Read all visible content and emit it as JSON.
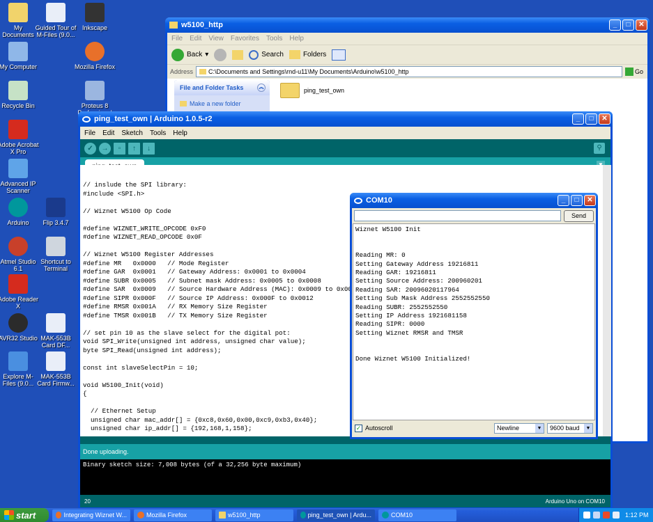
{
  "desktop": {
    "icons": [
      {
        "label": "My Documents",
        "color": "#f1d36b"
      },
      {
        "label": "Guided Tour of M-Files (9.0...",
        "color": "#e9eef8"
      },
      {
        "label": "Inkscape",
        "color": "#333333"
      },
      {
        "label": "My Computer",
        "color": "#8fb7e8"
      },
      {
        "label": "Mozilla Firefox",
        "color": "#e8702a"
      },
      {
        "label": "Recycle Bin",
        "color": "#c6e2c6"
      },
      {
        "label": "Proteus 8 Professional",
        "color": "#9bb6e0"
      },
      {
        "label": "Adobe Acrobat X Pro",
        "color": "#d52b1e"
      },
      {
        "label": "Advanced IP Scanner",
        "color": "#5fa4e8"
      },
      {
        "label": "Arduino",
        "color": "#00979c"
      },
      {
        "label": "Flip 3.4.7",
        "color": "#1a3a8c"
      },
      {
        "label": "Atmel Studio 6.1",
        "color": "#c8402a"
      },
      {
        "label": "Shortcut to Terminal",
        "color": "#cfd6de"
      },
      {
        "label": "Adobe Reader X",
        "color": "#d52b1e"
      },
      {
        "label": "AVR32 Studio",
        "color": "#2b2b2b"
      },
      {
        "label": "MAK-553B Card DF...",
        "color": "#e9eef8"
      },
      {
        "label": "Explore M-Files (9.0...",
        "color": "#4a8fe0"
      },
      {
        "label": "MAK-553B Card Firmw...",
        "color": "#e9eef8"
      }
    ]
  },
  "explorer": {
    "title": "w5100_http",
    "menu": [
      "File",
      "Edit",
      "View",
      "Favorites",
      "Tools",
      "Help"
    ],
    "toolbar": {
      "back": "Back",
      "search": "Search",
      "folders": "Folders"
    },
    "address_label": "Address",
    "address_value": "C:\\Documents and Settings\\rnd-u11\\My Documents\\Arduino\\w5100_http",
    "go_label": "Go",
    "tasks_title": "File and Folder Tasks",
    "task_make_folder": "Make a new folder",
    "folder_name": "ping_test_own"
  },
  "arduino": {
    "title": "ping_test_own | Arduino 1.0.5-r2",
    "menu": [
      "File",
      "Edit",
      "Sketch",
      "Tools",
      "Help"
    ],
    "tab_name": "ping_test_own",
    "code": "// inslude the SPI library:\n#include <SPI.h>\n\n// Wiznet W5100 Op Code\n\n#define WIZNET_WRITE_OPCODE 0xF0\n#define WIZNET_READ_OPCODE 0x0F\n\n// Wiznet W5100 Register Addresses\n#define MR   0x0000   // Mode Register\n#define GAR  0x0001   // Gateway Address: 0x0001 to 0x0004\n#define SUBR 0x0005   // Subnet mask Address: 0x0005 to 0x0008\n#define SAR  0x0009   // Source Hardware Address (MAC): 0x0009 to 0x000E\n#define SIPR 0x000F   // Source IP Address: 0x000F to 0x0012\n#define RMSR 0x001A   // RX Memory Size Register\n#define TMSR 0x001B   // TX Memory Size Register\n\n// set pin 10 as the slave select for the digital pot:\nvoid SPI_Write(unsigned int address, unsigned char value);\nbyte SPI_Read(unsigned int address);\n\nconst int slaveSelectPin = 10;\n\nvoid W5100_Init(void)\n{\n\n  // Ethernet Setup\n  unsigned char mac_addr[] = {0xc8,0x60,0x00,0xc9,0xb3,0x40};\n  unsigned char ip_addr[] = {192,168,1,158};",
    "status": "Done uploading.",
    "console": "Binary sketch size: 7,008 bytes (of a 32,256 byte maximum)",
    "line_number": "20",
    "board": "Arduino Uno on COM10",
    "accent": "#006468"
  },
  "serial": {
    "title": "COM10",
    "send_label": "Send",
    "output": "Wiznet W5100 Init\n\n\nReading MR: 0\nSetting Gateway Address 19216811\nReading GAR: 19216811\nSetting Source Address: 200960201\nReading SAR: 20096020117964\nSetting Sub Mask Address 2552552550\nReading SUBR: 2552552550\nSetting IP Address 1921681158\nReading SIPR: 0000\nSetting Wiznet RMSR and TMSR\n\n\nDone Wiznet W5100 Initialized!",
    "autoscroll_label": "Autoscroll",
    "line_ending": "Newline",
    "baud": "9600 baud"
  },
  "taskbar": {
    "start_label": "start",
    "tasks": [
      {
        "label": "Integrating Wiznet W...",
        "color": "#e8702a"
      },
      {
        "label": "Mozilla Firefox",
        "color": "#e8702a"
      },
      {
        "label": "w5100_http",
        "color": "#f1d36b"
      },
      {
        "label": "ping_test_own | Ardu...",
        "color": "#00979c"
      },
      {
        "label": "COM10",
        "color": "#00979c"
      }
    ],
    "clock": "1:12 PM"
  }
}
